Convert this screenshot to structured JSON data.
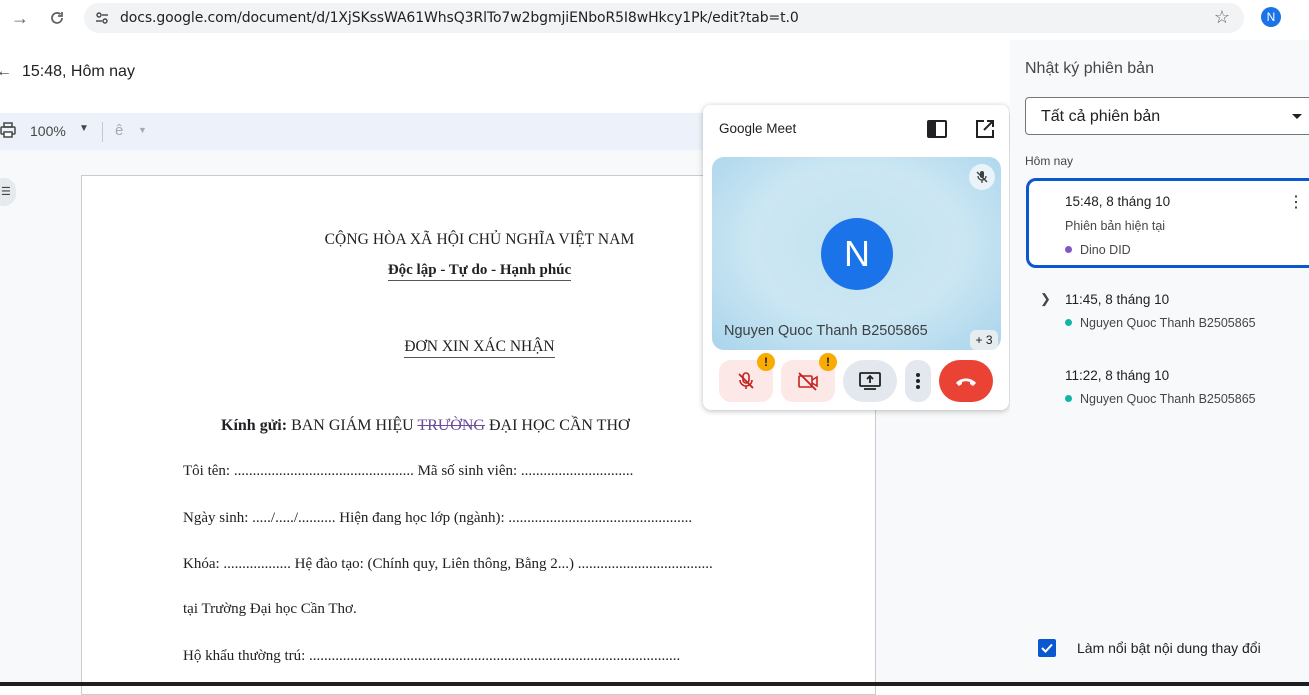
{
  "browser": {
    "url": "docs.google.com/document/d/1XjSKssWA61WhsQ3RlTo7w2bgmjiENboR5I8wHkcy1Pk/edit?tab=t.0",
    "profile_initial": "N"
  },
  "doc_header": {
    "version_time": "15:48, Hôm nay"
  },
  "toolbar": {
    "zoom": "100%"
  },
  "document": {
    "title1": "CỘNG HÒA XÃ HỘI CHỦ NGHĨA VIỆT NAM",
    "title2": "Độc lập - Tự do - Hạnh phúc",
    "title3": "ĐƠN XIN XÁC NHẬN",
    "kinhgui_prefix": "Kính gửi:",
    "kinhgui_a": " BAN GIÁM HIỆU ",
    "kinhgui_strike": "TRƯỜNG",
    "kinhgui_b": " ĐẠI HỌC CẦN THƠ",
    "lines": [
      "Tôi tên: ................................................   Mã số sinh viên: ..............................",
      "Ngày sinh: ...../...../..........   Hiện đang học lớp (ngành): .................................................",
      "Khóa: ..................   Hệ đào tạo: (Chính quy, Liên thông, Bằng 2...) ....................................",
      "tại Trường Đại học Cần Thơ.",
      "Hộ khẩu thường trú: ..................................................................................................."
    ]
  },
  "meet": {
    "title": "Google Meet",
    "avatar_initial": "N",
    "participant_name": "Nguyen Quoc Thanh B2505865",
    "more_count": "+ 3",
    "warning_mark": "!"
  },
  "version_panel": {
    "title": "Nhật ký phiên bản",
    "filter": "Tất cả phiên bản",
    "section": "Hôm nay",
    "versions": [
      {
        "time": "15:48, 8 tháng 10",
        "label": "Phiên bản hiện tại",
        "user": "Dino DID",
        "color": "#7e57c2"
      },
      {
        "time": "11:45, 8 tháng 10",
        "user": "Nguyen Quoc Thanh B2505865",
        "color": "#12b5a5"
      },
      {
        "time": "11:22, 8 tháng 10",
        "user": "Nguyen Quoc Thanh B2505865",
        "color": "#12b5a5"
      }
    ],
    "highlight_label": "Làm nổi bật nội dung thay đổi"
  },
  "colors": {
    "accent": "#0b57d0",
    "end_call": "#ea4335",
    "warning": "#f9ab00"
  }
}
